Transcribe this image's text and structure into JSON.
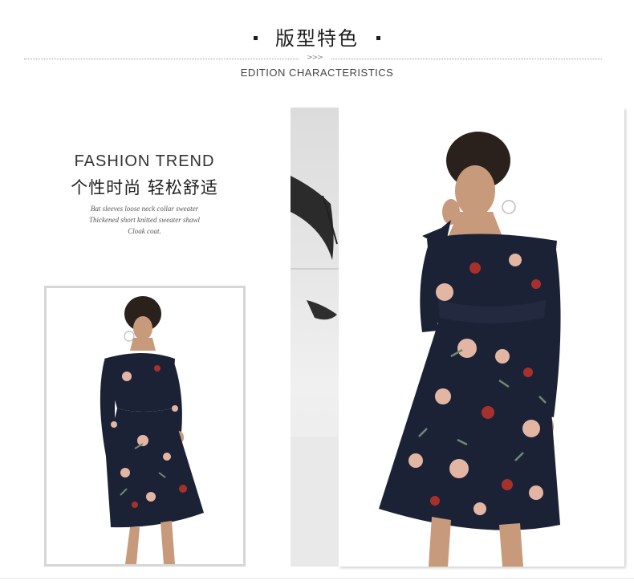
{
  "header": {
    "title": "版型特色",
    "arrows": ">>>",
    "subtitle": "EDITION CHARACTERISTICS"
  },
  "trend": {
    "title_en": "FASHION TREND",
    "title_zh": "个性时尚 轻松舒适",
    "description": [
      "Bat sleeves loose neck collar sweater",
      "Thickened short knitted sweater shawl",
      "Cloak coat."
    ]
  },
  "colors": {
    "dress": "#1c2236",
    "skin": "#c79a7c",
    "hair": "#2a211c",
    "flower_pink": "#e3b6a4",
    "flower_red": "#a8302c",
    "leaf": "#6e8a72",
    "frame": "#d6d6d6"
  },
  "icons": [
    "bullet-square-icon",
    "triple-arrow-icon"
  ]
}
